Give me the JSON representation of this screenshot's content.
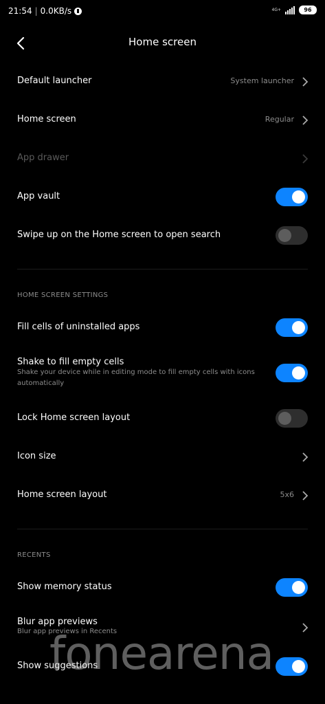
{
  "status_bar": {
    "time": "21:54",
    "network_speed": "0.0KB/s",
    "network_type": "4G+",
    "battery": "96",
    "icons": [
      "vpn-key-icon",
      "signal-icon",
      "battery-icon"
    ]
  },
  "header": {
    "title": "Home screen",
    "back_icon": "back-arrow-icon"
  },
  "rows": {
    "default_launcher": {
      "label": "Default launcher",
      "value": "System launcher"
    },
    "home_screen": {
      "label": "Home screen",
      "value": "Regular"
    },
    "app_drawer": {
      "label": "App drawer"
    },
    "app_vault": {
      "label": "App vault",
      "checked": true
    },
    "swipe_up": {
      "label": "Swipe up on the Home screen to open search",
      "checked": false
    },
    "fill_cells": {
      "label": "Fill cells of uninstalled apps",
      "checked": true
    },
    "shake_fill": {
      "label": "Shake to fill empty cells",
      "sub": "Shake your device while in editing mode to fill empty cells with icons automatically",
      "checked": true
    },
    "lock_layout": {
      "label": "Lock Home screen layout",
      "checked": false
    },
    "icon_size": {
      "label": "Icon size"
    },
    "layout": {
      "label": "Home screen layout",
      "value": "5x6"
    },
    "memory_status": {
      "label": "Show memory status",
      "checked": true
    },
    "blur_previews": {
      "label": "Blur app previews",
      "sub": "Blur app previews in Recents"
    },
    "suggestions": {
      "label": "Show suggestions",
      "checked": true
    }
  },
  "sections": {
    "home_screen_settings": "HOME SCREEN SETTINGS",
    "recents": "RECENTS"
  },
  "watermark": "fonearena",
  "colors": {
    "background": "#000000",
    "toggle_on": "#0d84ff",
    "toggle_off": "#2e2e2e",
    "secondary_text": "#8c8c8c",
    "disabled_text": "#5a5a5a"
  }
}
